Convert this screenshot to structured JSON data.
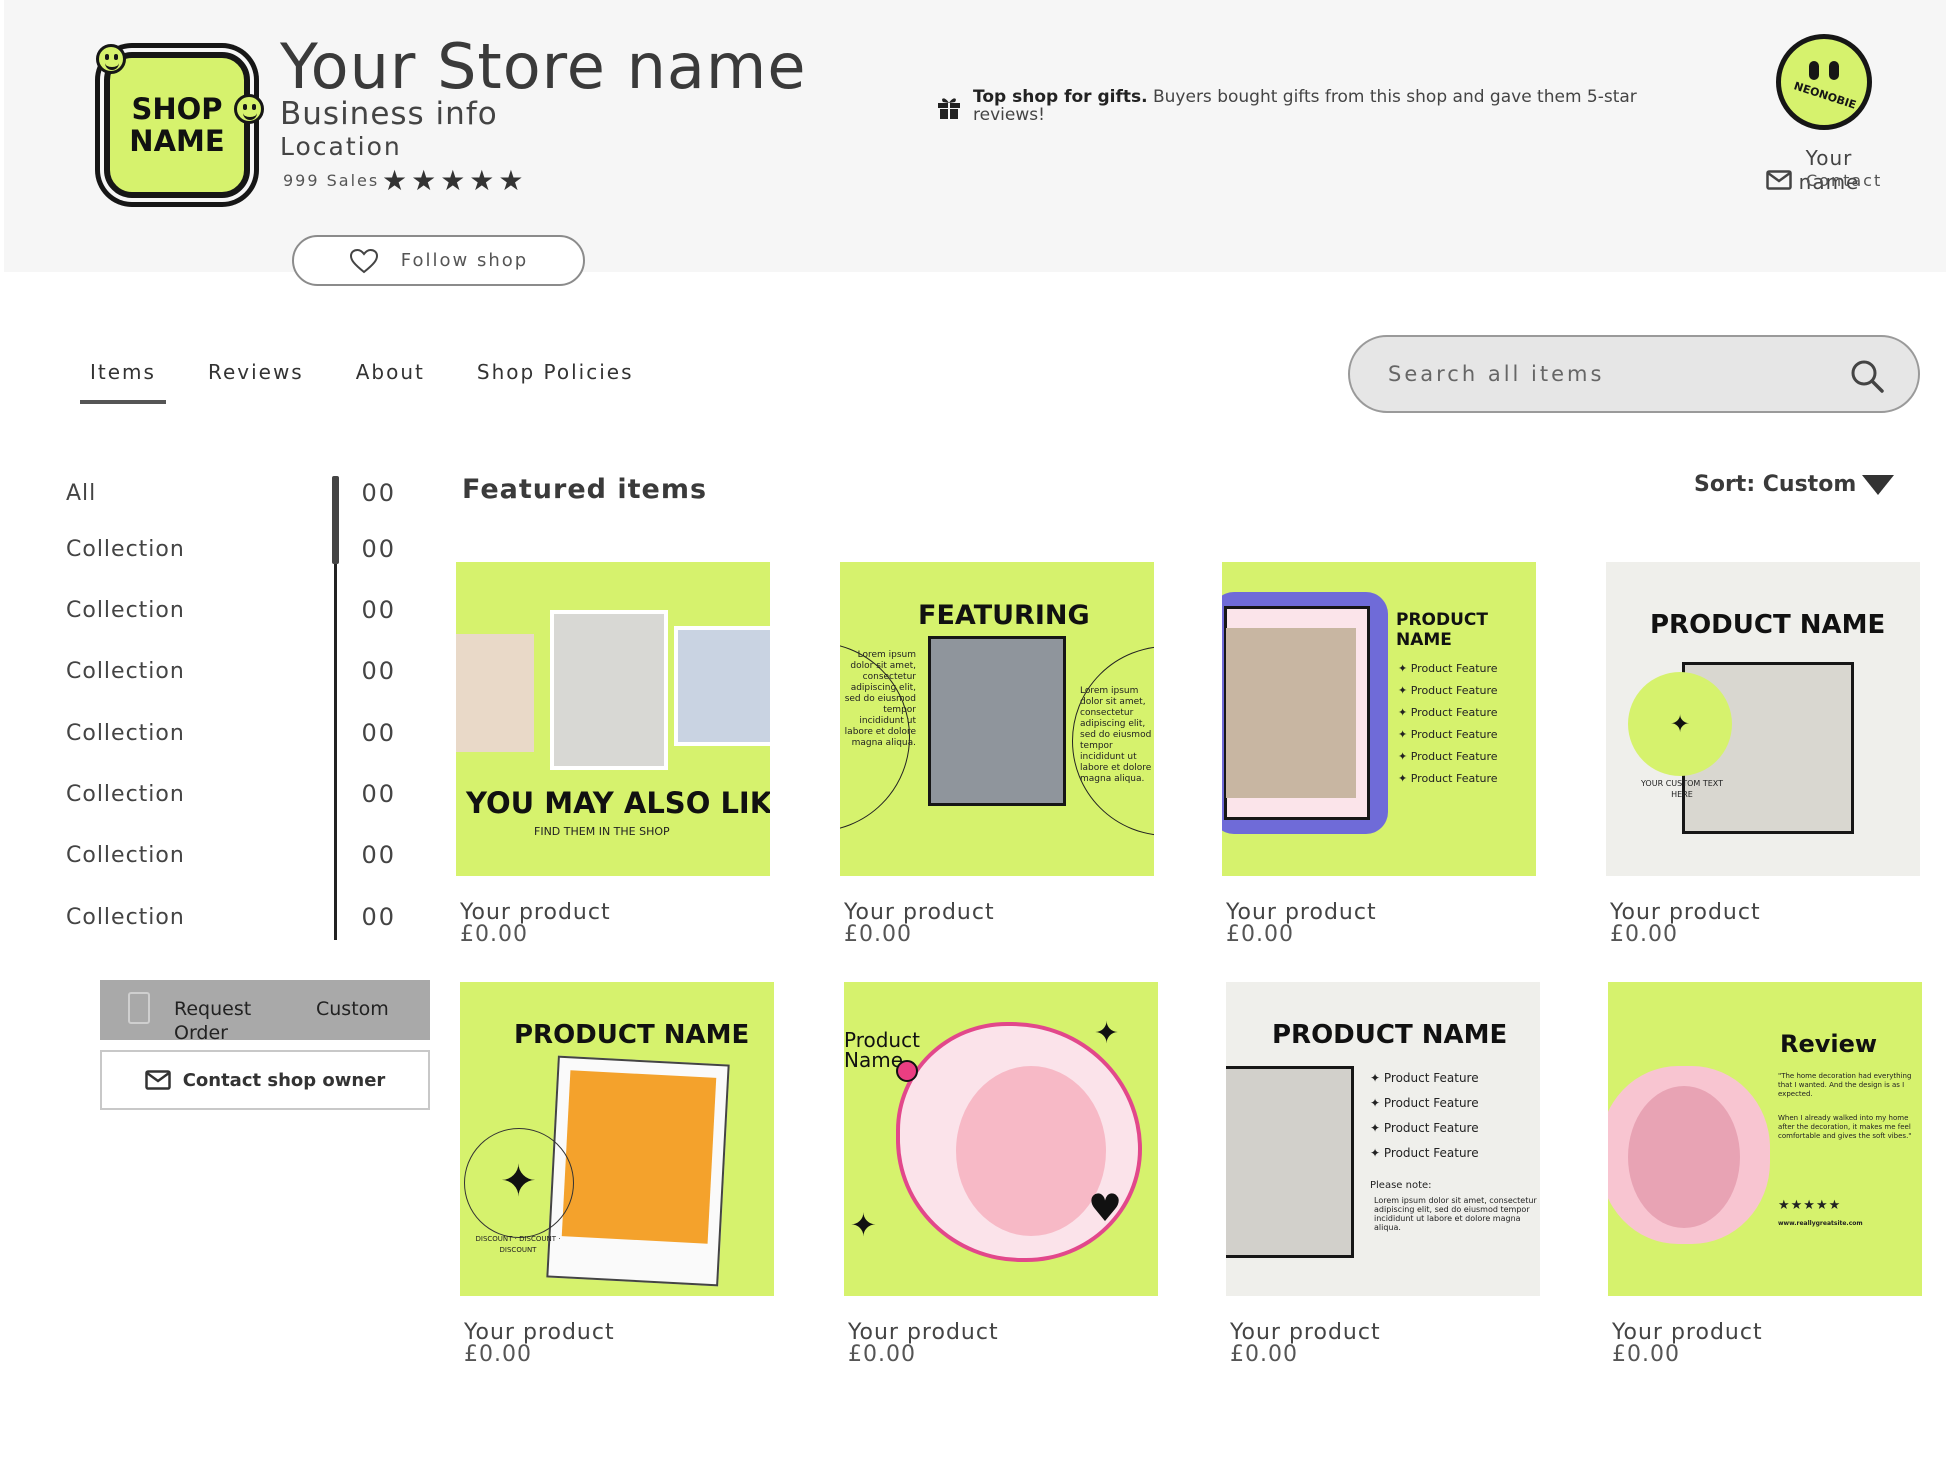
{
  "header": {
    "logo_line1": "SHOP",
    "logo_line2": "NAME",
    "store_name": "Your Store name",
    "business_info": "Business info",
    "location": "Location",
    "sales": "999 Sales",
    "rating_stars": "★★★★★",
    "follow_label": "Follow shop",
    "gift_bold": "Top shop for gifts.",
    "gift_text": " Buyers bought gifts from this shop and gave them 5-star reviews!",
    "owner_avatar_word": "NEONOBIE",
    "owner_name": "Your name",
    "contact_label": "Contact"
  },
  "tabs": [
    {
      "label": "Items"
    },
    {
      "label": "Reviews"
    },
    {
      "label": "About"
    },
    {
      "label": "Shop Policies"
    }
  ],
  "search": {
    "placeholder": "Search all items"
  },
  "sidebar": {
    "items": [
      {
        "label": "All",
        "count": "00"
      },
      {
        "label": "Collection",
        "count": "00"
      },
      {
        "label": "Collection",
        "count": "00"
      },
      {
        "label": "Collection",
        "count": "00"
      },
      {
        "label": "Collection",
        "count": "00"
      },
      {
        "label": "Collection",
        "count": "00"
      },
      {
        "label": "Collection",
        "count": "00"
      },
      {
        "label": "Collection",
        "count": "00"
      }
    ],
    "request_part1": "Request",
    "request_part2": "Custom",
    "request_part3": "Order",
    "contact_owner": "Contact shop owner"
  },
  "main": {
    "title": "Featured items",
    "sort_label": "Sort: Custom"
  },
  "products": [
    {
      "name": "Your product",
      "price": "£0.00",
      "art_title": "YOU MAY ALSO LIKE",
      "art_sub": "FIND THEM IN THE SHOP"
    },
    {
      "name": "Your product",
      "price": "£0.00",
      "art_title": "FEATURING",
      "art_text": "Lorem ipsum dolor sit amet, consectetur adipiscing elit, sed do eiusmod tempor incididunt ut labore et dolore magna aliqua."
    },
    {
      "name": "Your product",
      "price": "£0.00",
      "art_title": "PRODUCT NAME",
      "features": [
        "Product Feature",
        "Product Feature",
        "Product Feature",
        "Product Feature",
        "Product Feature",
        "Product Feature"
      ]
    },
    {
      "name": "Your product",
      "price": "£0.00",
      "art_title": "PRODUCT NAME",
      "art_badge": "YOUR CUSTOM TEXT HERE"
    },
    {
      "name": "Your product",
      "price": "£0.00",
      "art_title": "PRODUCT NAME",
      "art_ring": "DISCOUNT · DISCOUNT · DISCOUNT"
    },
    {
      "name": "Your product",
      "price": "£0.00",
      "art_title": "Product Name"
    },
    {
      "name": "Your product",
      "price": "£0.00",
      "art_title": "PRODUCT NAME",
      "features": [
        "Product Feature",
        "Product Feature",
        "Product Feature",
        "Product Feature"
      ],
      "note_title": "Please note:",
      "note_text": "Lorem ipsum dolor sit amet, consectetur adipiscing elit, sed do eiusmod tempor incididunt ut labore et dolore magna aliqua."
    },
    {
      "name": "Your product",
      "price": "£0.00",
      "art_title": "Review",
      "review_1": "\"The home decoration had everything that I wanted. And the design is as I expected.",
      "review_2": "When I already walked into my home after the decoration, it makes me feel comfortable and gives the soft vibes.\"",
      "review_stars": "★★★★★",
      "review_site": "www.reallygreatsite.com"
    }
  ],
  "colors": {
    "lime": "#d6f26d",
    "ink": "#161616",
    "header_bg": "#f6f6f6",
    "pink": "#f7c6d3",
    "purple": "#6f6bd8"
  }
}
